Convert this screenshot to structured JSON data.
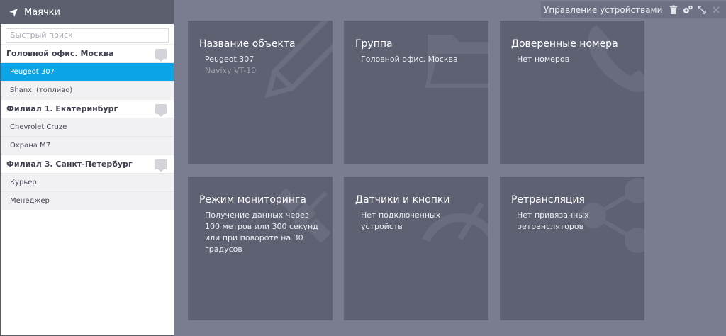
{
  "sidebar": {
    "title": "Маячки",
    "search_placeholder": "Быстрый поиск",
    "groups": [
      {
        "name": "Головной офис. Москва",
        "items": [
          "Peugeot 307",
          "Shanxi (топливо)"
        ]
      },
      {
        "name": "Филиал 1. Екатеринбург",
        "items": [
          "Chevrolet Cruze",
          "Охрана М7"
        ]
      },
      {
        "name": "Филиал 3. Санкт-Петербург",
        "items": [
          "Курьер",
          "Менеджер"
        ]
      }
    ]
  },
  "topbar": {
    "title": "Управление устройствами"
  },
  "tiles": [
    {
      "title": "Название объекта",
      "lines": [
        "Peugeot 307",
        "Navixy VT-10"
      ],
      "icon": "pencil-icon"
    },
    {
      "title": "Группа",
      "lines": [
        "Головной офис. Москва"
      ],
      "icon": "folder-icon"
    },
    {
      "title": "Доверенные номера",
      "lines": [
        "Нет номеров"
      ],
      "icon": "phone-icon"
    },
    {
      "title": "Режим мониторинга",
      "lines": [
        "Получение данных через 100 метров или 300 секунд или при повороте на 30 градусов"
      ],
      "icon": "satellite-icon"
    },
    {
      "title": "Датчики и кнопки",
      "lines": [
        "Нет подключенных устройств"
      ],
      "icon": "gauge-icon"
    },
    {
      "title": "Ретрансляция",
      "lines": [
        "Нет привязанных ретрансляторов"
      ],
      "icon": "share-icon"
    }
  ],
  "colors": {
    "background": "#7a7d8f",
    "tile": "#5e6172",
    "sidebar_header": "#5c5f6e",
    "selected": "#0aa5e7"
  }
}
